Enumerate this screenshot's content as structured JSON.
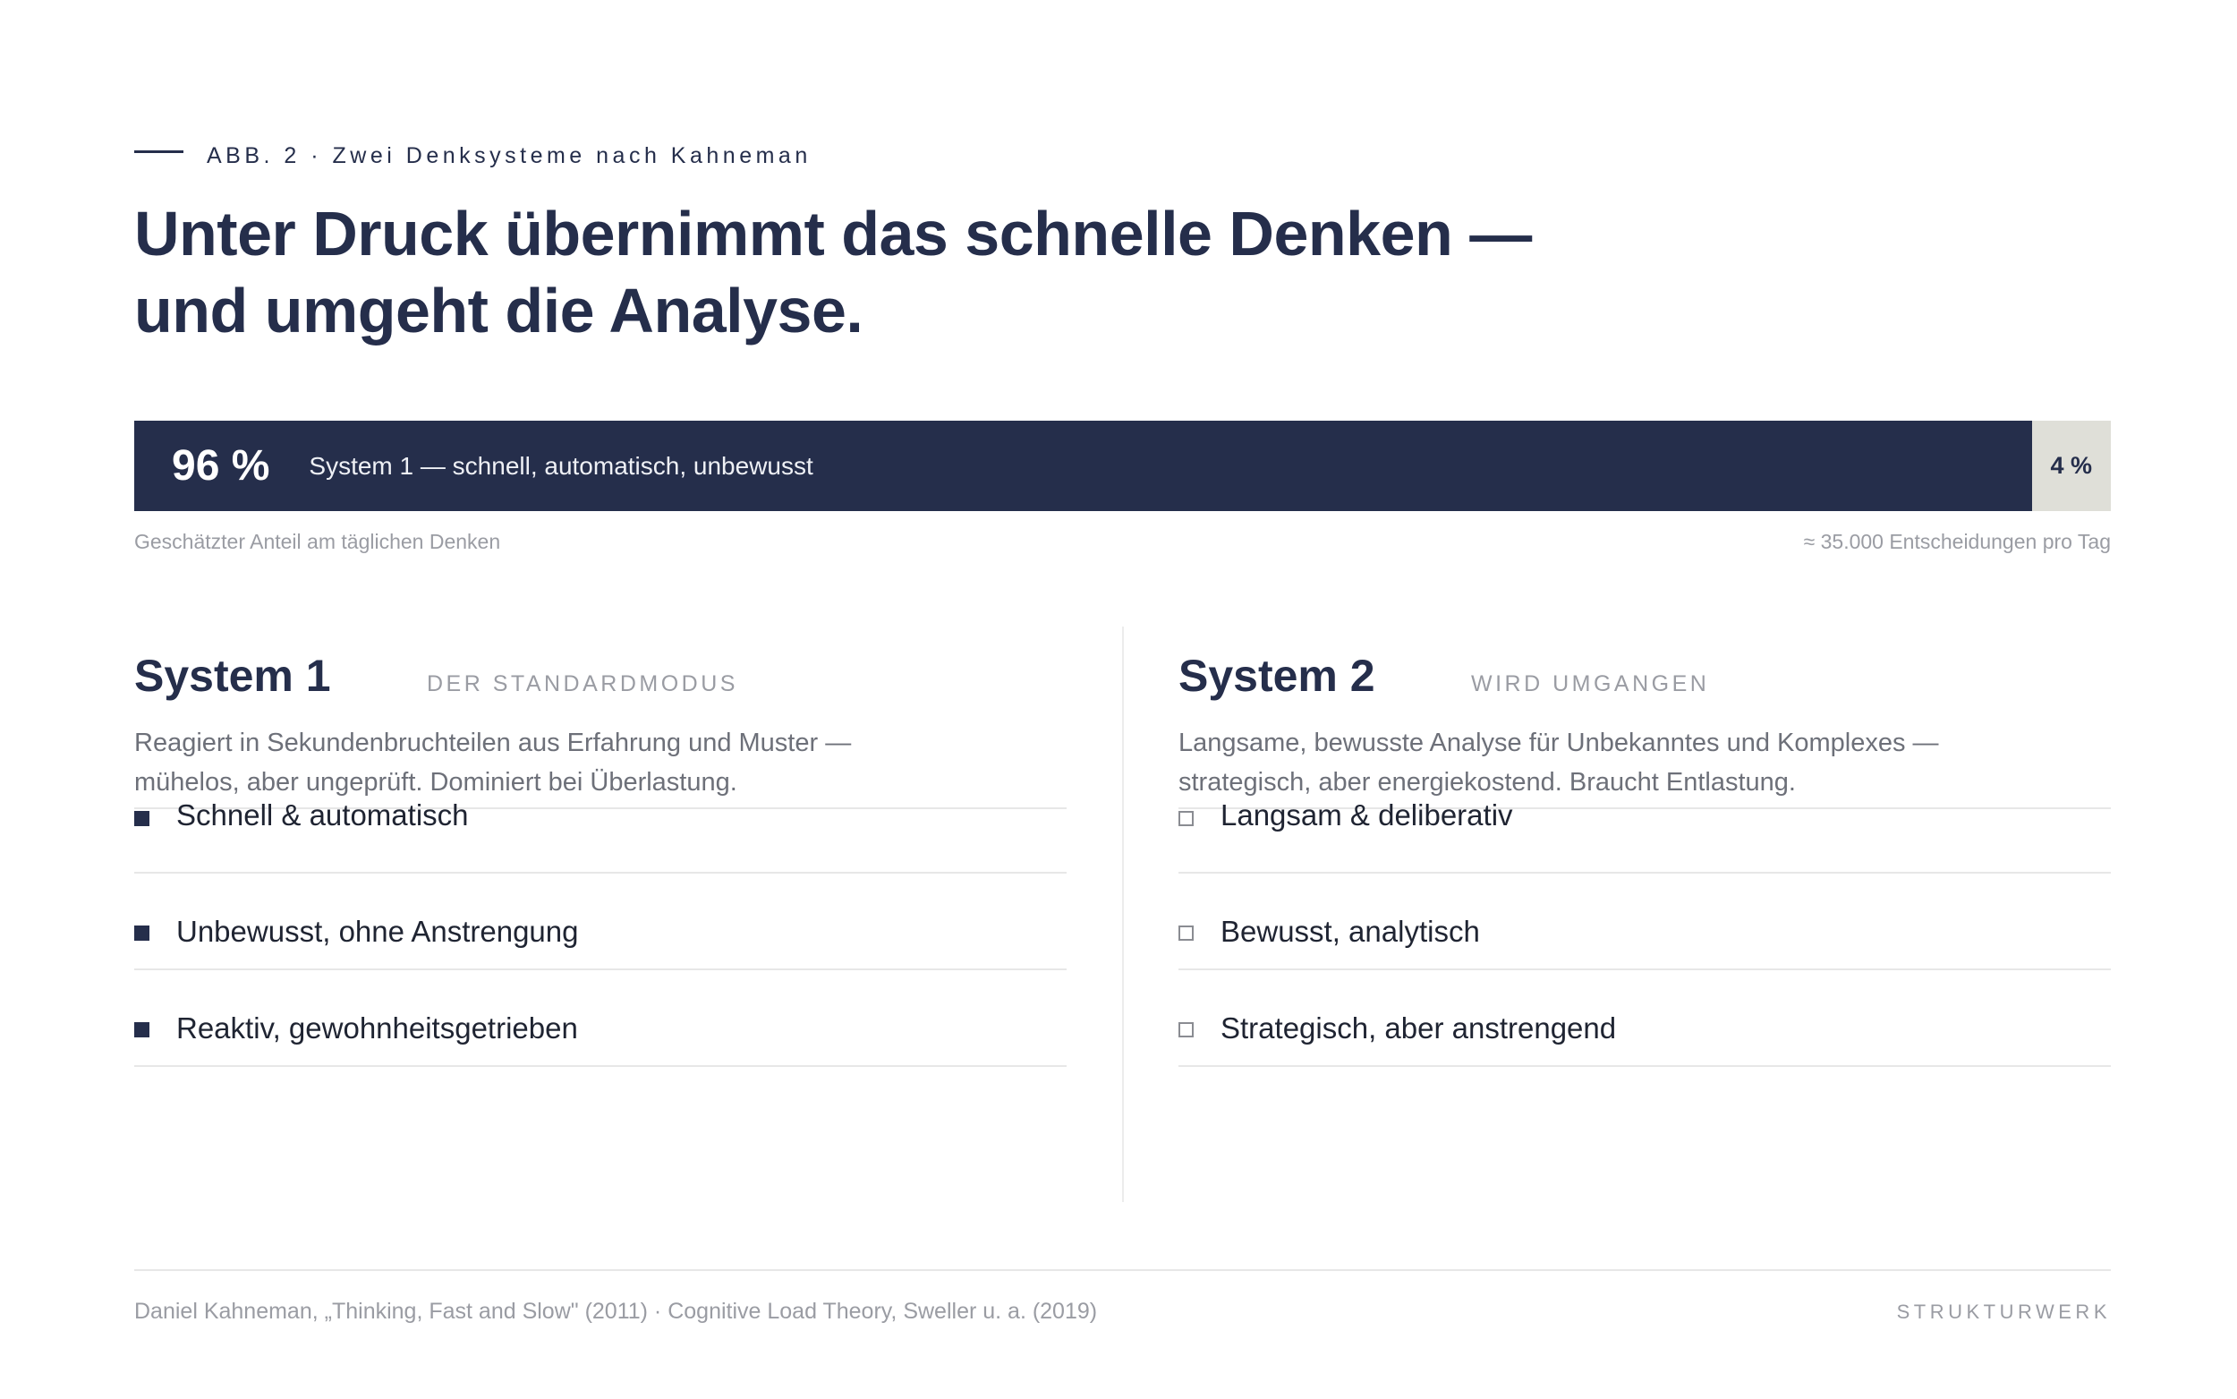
{
  "eyebrow": "ABB. 2 · Zwei Denksysteme nach Kahneman",
  "title": "Unter Druck übernimmt das schnelle Denken — und umgeht die Analyse.",
  "bar": {
    "system1_percent": 96,
    "system1_label": "96 %",
    "system1_text": "System 1 — schnell, automatisch, unbewusst",
    "system2_percent": 4,
    "system2_label": "4 %",
    "caption_left": "Geschätzter Anteil am täglichen Denken",
    "caption_right": "≈ 35.000 Entscheidungen pro Tag",
    "colors": {
      "system1": "#252e4b",
      "system2": "#dfdfd8"
    }
  },
  "system1": {
    "title": "System 1",
    "tag": "DER STANDARDMODUS",
    "description": "Reagiert in Sekundenbruchteilen aus Erfahrung und Muster — mühelos, aber ungeprüft. Dominiert bei Überlastung.",
    "items": [
      "Schnell & automatisch",
      "Unbewusst, ohne Anstrengung",
      "Reaktiv, gewohnheitsgetrieben"
    ]
  },
  "system2": {
    "title": "System 2",
    "tag": "WIRD UMGANGEN",
    "description": "Langsame, bewusste Analyse für Unbekanntes und Komplexes — strategisch, aber energiekostend. Braucht Entlastung.",
    "items": [
      "Langsam & deliberativ",
      "Bewusst, analytisch",
      "Strategisch, aber anstrengend"
    ]
  },
  "footer": {
    "source": "Daniel Kahneman, „Thinking, Fast and Slow\" (2011) · Cognitive Load Theory, Sweller u. a. (2019)",
    "brand": "STRUKTURWERK"
  }
}
